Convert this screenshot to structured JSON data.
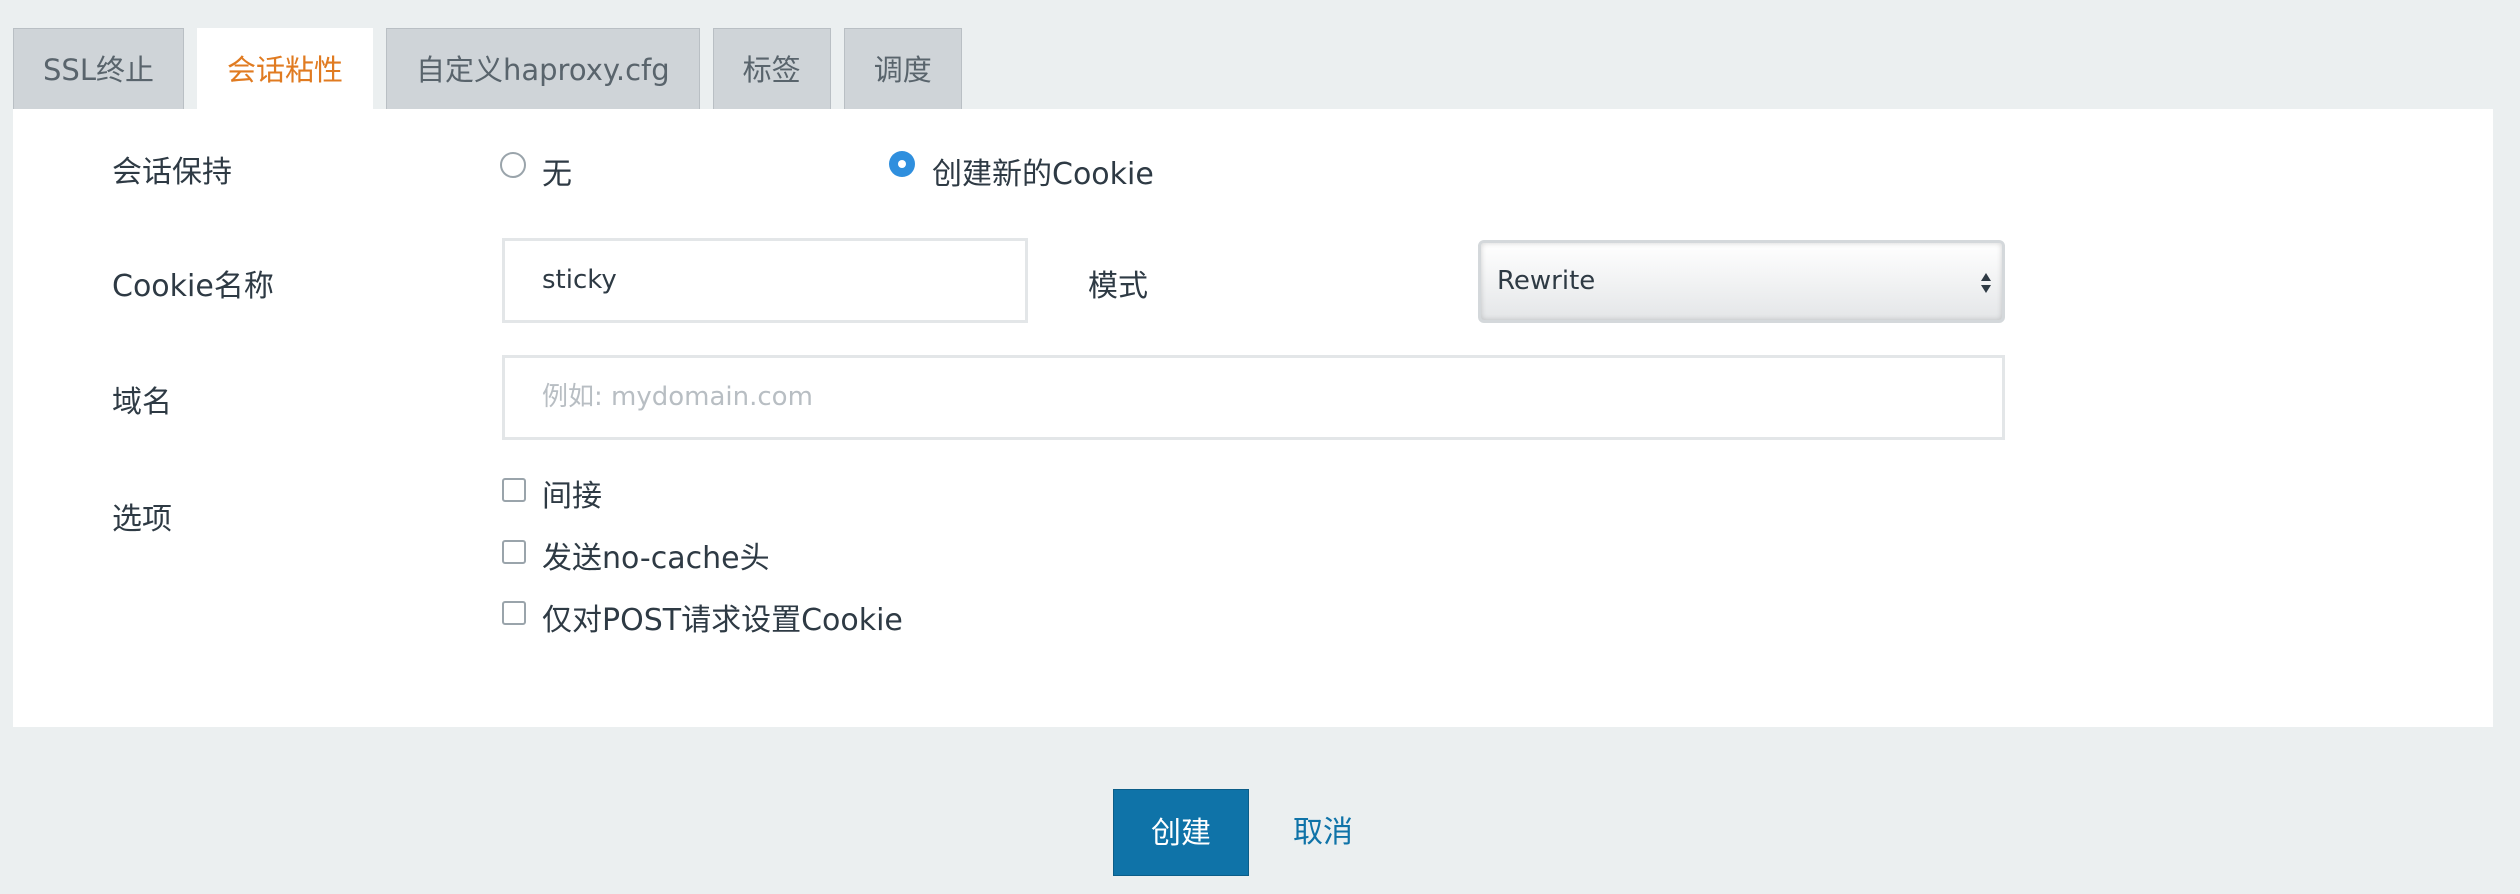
{
  "tabs": [
    {
      "label": "SSL终止",
      "active": false
    },
    {
      "label": "会话粘性",
      "active": true
    },
    {
      "label": "自定义haproxy.cfg",
      "active": false
    },
    {
      "label": "标签",
      "active": false
    },
    {
      "label": "调度",
      "active": false
    }
  ],
  "form": {
    "session_persistence": {
      "label": "会话保持",
      "options": [
        {
          "label": "无",
          "checked": false
        },
        {
          "label": "创建新的Cookie",
          "checked": true
        }
      ]
    },
    "cookie_name": {
      "label": "Cookie名称",
      "value": "sticky"
    },
    "mode": {
      "label": "模式",
      "selected": "Rewrite"
    },
    "domain": {
      "label": "域名",
      "value": "",
      "placeholder": "例如: mydomain.com"
    },
    "options": {
      "label": "选项",
      "items": [
        {
          "label": "间接",
          "checked": false
        },
        {
          "label": "发送no-cache头",
          "checked": false
        },
        {
          "label": "仅对POST请求设置Cookie",
          "checked": false
        }
      ]
    }
  },
  "actions": {
    "create_label": "创建",
    "cancel_label": "取消"
  },
  "colors": {
    "accent": "#e07b21",
    "primary": "#0f73a8",
    "radio_checked": "#2f8fde",
    "background": "#ebeff0"
  }
}
